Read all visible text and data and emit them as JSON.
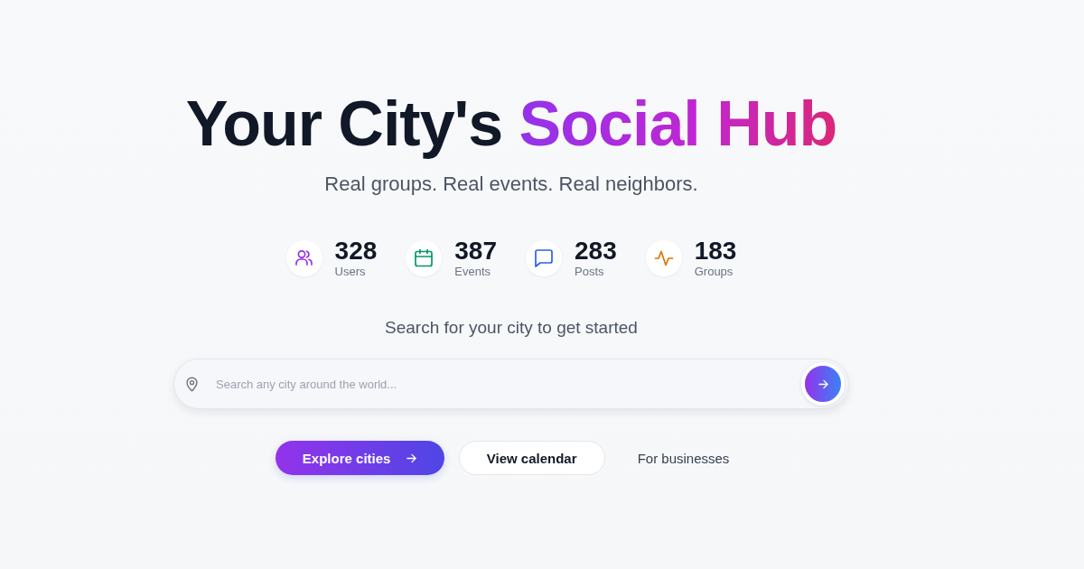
{
  "hero": {
    "title": "Your City's",
    "title_highlight": "Social Hub",
    "subtitle": "Real groups. Real events. Real neighbors."
  },
  "stats": [
    {
      "kind": "users",
      "value": "328",
      "label": "Users"
    },
    {
      "kind": "events",
      "value": "387",
      "label": "Events"
    },
    {
      "kind": "posts",
      "value": "283",
      "label": "Posts"
    },
    {
      "kind": "groups",
      "value": "183",
      "label": "Groups"
    }
  ],
  "search": {
    "prompt": "Search for your city to get started",
    "placeholder": "Search any city around the world..."
  },
  "actions": [
    {
      "kind": "primary",
      "label": "Explore cities"
    },
    {
      "kind": "secondary",
      "label": "View calendar"
    },
    {
      "kind": "link",
      "label": "For businesses"
    }
  ]
}
